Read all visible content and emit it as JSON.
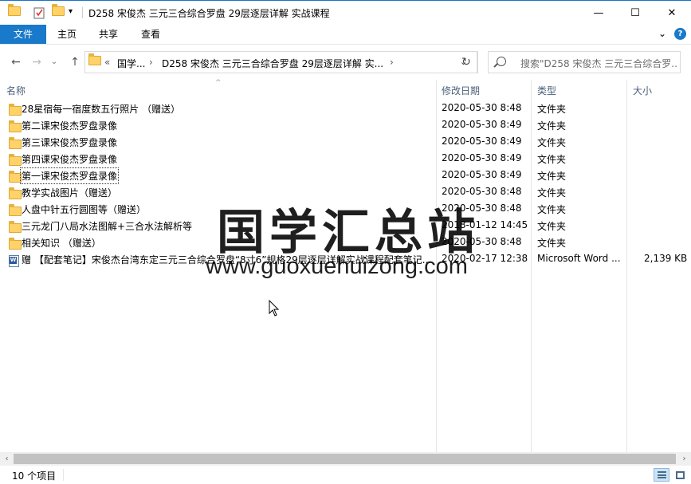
{
  "window": {
    "title": "D258 宋俊杰 三元三合综合罗盘 29层逐层详解  实战课程",
    "controls": {
      "minimize": "—",
      "maximize": "☐",
      "close": "✕"
    }
  },
  "ribbon": {
    "tabs": [
      "文件",
      "主页",
      "共享",
      "查看"
    ],
    "help": "?",
    "expand": "⌄"
  },
  "nav": {
    "back": "←",
    "forward": "→",
    "recent": "⌄",
    "up": "↑",
    "refresh": "↻"
  },
  "address": {
    "overflow": "«",
    "segments": [
      "国学...",
      "D258 宋俊杰 三元三合综合罗盘 29层逐层详解  实..."
    ],
    "separator": "›",
    "dropdown": "⌄"
  },
  "search": {
    "placeholder": "搜索\"D258 宋俊杰 三元三合综合罗...\""
  },
  "columns": {
    "name": "名称",
    "date": "修改日期",
    "type": "类型",
    "size": "大小"
  },
  "files": [
    {
      "name": "28星宿每一宿度数五行照片 （赠送）",
      "date": "2020-05-30 8:48",
      "type": "文件夹",
      "size": "",
      "icon": "folder-icon"
    },
    {
      "name": "第二课宋俊杰罗盘录像",
      "date": "2020-05-30 8:49",
      "type": "文件夹",
      "size": "",
      "icon": "folder-icon"
    },
    {
      "name": "第三课宋俊杰罗盘录像",
      "date": "2020-05-30 8:49",
      "type": "文件夹",
      "size": "",
      "icon": "folder-icon"
    },
    {
      "name": "第四课宋俊杰罗盘录像",
      "date": "2020-05-30 8:49",
      "type": "文件夹",
      "size": "",
      "icon": "folder-icon"
    },
    {
      "name": "第一课宋俊杰罗盘录像",
      "date": "2020-05-30 8:49",
      "type": "文件夹",
      "size": "",
      "icon": "folder-icon",
      "focused": true
    },
    {
      "name": "教学实战图片（赠送）",
      "date": "2020-05-30 8:48",
      "type": "文件夹",
      "size": "",
      "icon": "folder-icon"
    },
    {
      "name": "人盘中针五行圆图等（赠送）",
      "date": "2020-05-30 8:48",
      "type": "文件夹",
      "size": "",
      "icon": "folder-icon"
    },
    {
      "name": "三元龙门八局水法图解+三合水法解析等",
      "date": "2018-01-12 14:45",
      "type": "文件夹",
      "size": "",
      "icon": "folder-icon"
    },
    {
      "name": "相关知识 （赠送）",
      "date": "2020-05-30 8:48",
      "type": "文件夹",
      "size": "",
      "icon": "folder-icon"
    },
    {
      "name": "赠 【配套笔记】宋俊杰台湾东定三元三合综合罗盘“8寸6”规格29层逐层详解实战课程配套笔记...",
      "date": "2020-02-17 12:38",
      "type": "Microsoft Word ...",
      "size": "2,139 KB",
      "icon": "word-document-icon"
    }
  ],
  "watermark": {
    "cn": "国学汇总站",
    "url": "www.guoxuehuizong.com"
  },
  "scrollbar": {
    "left": "‹",
    "right": "›"
  },
  "status": {
    "item_count": "10 个项目"
  }
}
